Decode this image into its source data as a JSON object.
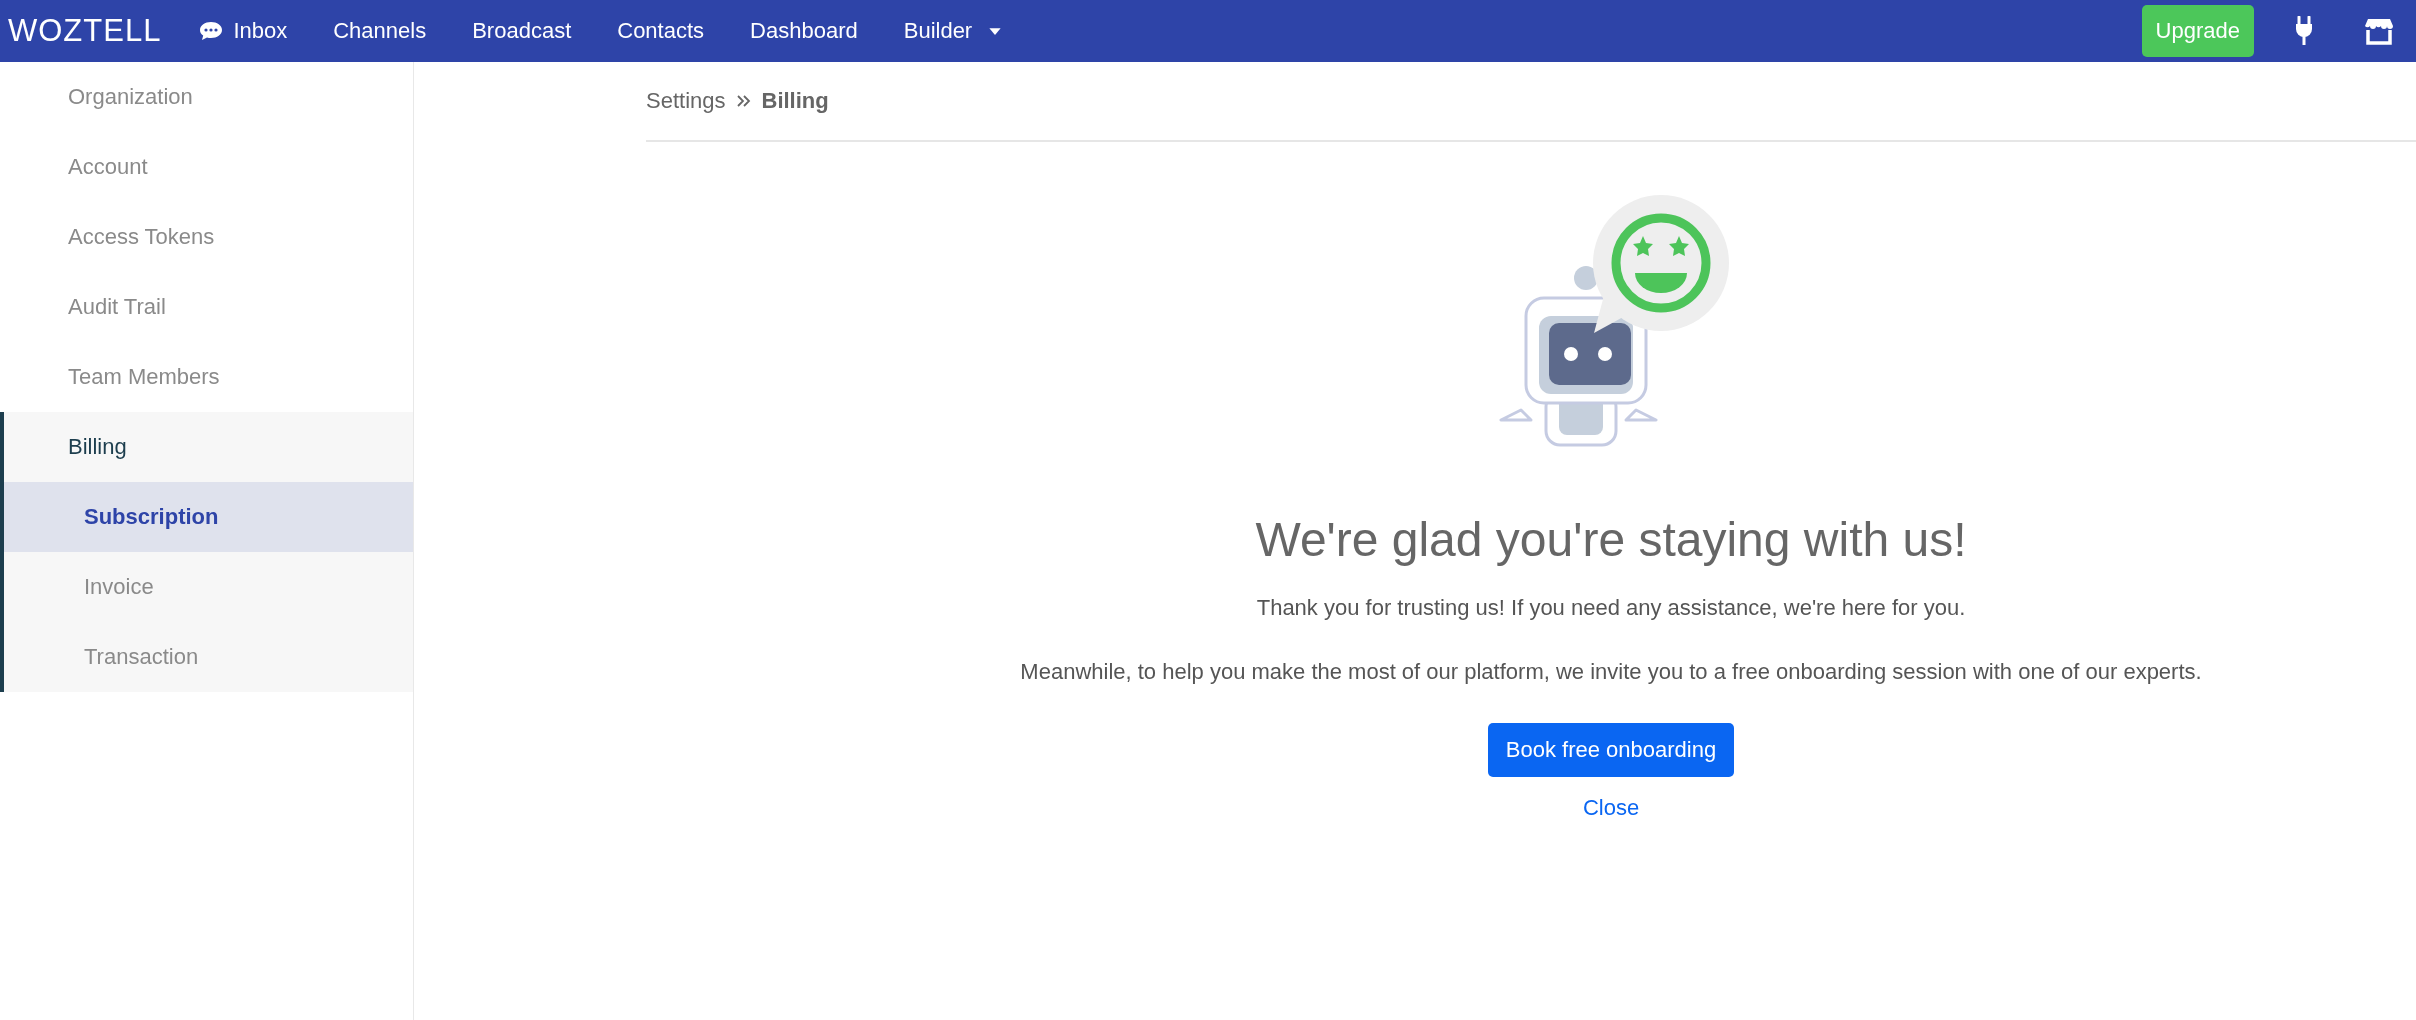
{
  "topbar": {
    "logo": "WOZTELL",
    "nav": [
      {
        "label": "Inbox",
        "kind": "chat"
      },
      {
        "label": "Channels",
        "kind": "plain"
      },
      {
        "label": "Broadcast",
        "kind": "plain"
      },
      {
        "label": "Contacts",
        "kind": "plain"
      },
      {
        "label": "Dashboard",
        "kind": "plain"
      },
      {
        "label": "Builder",
        "kind": "dropdown"
      }
    ],
    "upgrade": "Upgrade"
  },
  "sidebar": {
    "items": [
      {
        "label": "Organization",
        "selected": false
      },
      {
        "label": "Account",
        "selected": false
      },
      {
        "label": "Access Tokens",
        "selected": false
      },
      {
        "label": "Audit Trail",
        "selected": false
      },
      {
        "label": "Team Members",
        "selected": false
      },
      {
        "label": "Billing",
        "selected": false,
        "expanded": true,
        "children": [
          {
            "label": "Subscription",
            "selected": true
          },
          {
            "label": "Invoice",
            "selected": false
          },
          {
            "label": "Transaction",
            "selected": false
          }
        ]
      }
    ]
  },
  "breadcrumb": [
    "Settings",
    "Billing"
  ],
  "message": {
    "title": "We're glad you're staying with us!",
    "paragraphs": [
      "Thank you for trusting us! If you need any assistance, we're here for you.",
      "Meanwhile, to help you make the most of our platform, we invite you to a free onboarding session with one of our experts."
    ],
    "primary_button": "Book free onboarding",
    "link": "Close"
  }
}
